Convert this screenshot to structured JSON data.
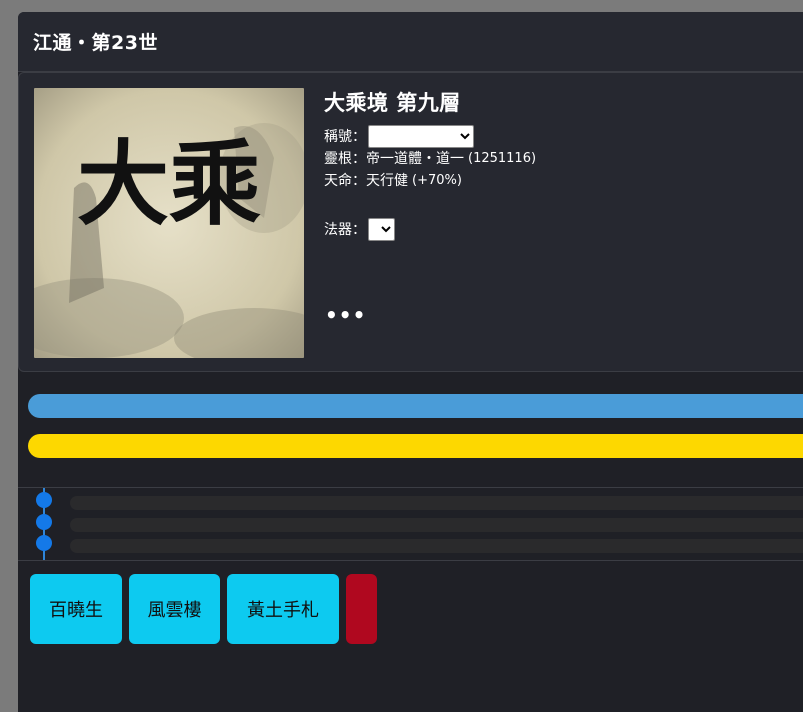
{
  "header": {
    "title": "江通・第23世"
  },
  "profile": {
    "portrait_text": "大乘",
    "realm": "大乘境 第九層",
    "title_label": "稱號：",
    "title_value": "",
    "root_label": "靈根：",
    "root_value": "帝一道體・道一",
    "root_code": "(1251116)",
    "fate_label": "天命：",
    "fate_value": "天行健",
    "fate_bonus": "(+70%)",
    "artifact_label": "法器：",
    "artifact_value": "",
    "more_label": "•••"
  },
  "progress": {
    "blue_fraction": 1.0,
    "yellow_fraction": 1.0,
    "colors": {
      "blue": "#4a9cd8",
      "yellow": "#fdd800"
    }
  },
  "log_entries": [
    "",
    "",
    ""
  ],
  "buttons": [
    {
      "label": "百曉生"
    },
    {
      "label": "風雲樓"
    },
    {
      "label": "黃土手札"
    },
    {
      "label": ""
    }
  ],
  "colors": {
    "accent_cyan": "#0dcaf0",
    "danger_red": "#b0081f",
    "timeline_blue": "#1479e8",
    "card_bg": "#262830"
  }
}
